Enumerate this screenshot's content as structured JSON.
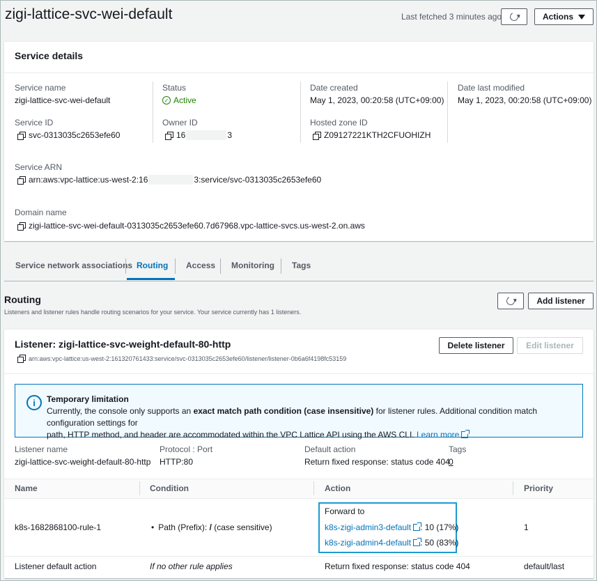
{
  "header": {
    "title": "zigi-lattice-svc-wei-default",
    "last_fetched": "Last fetched 3 minutes ago",
    "actions_label": "Actions"
  },
  "service_details": {
    "heading": "Service details",
    "fields": {
      "service_name_label": "Service name",
      "service_name": "zigi-lattice-svc-wei-default",
      "status_label": "Status",
      "status": "Active",
      "date_created_label": "Date created",
      "date_created": "May 1, 2023, 00:20:58 (UTC+09:00)",
      "date_modified_label": "Date last modified",
      "date_modified": "May 1, 2023, 00:20:58 (UTC+09:00)",
      "service_id_label": "Service ID",
      "service_id": "svc-0313035c2653efe60",
      "owner_id_label": "Owner ID",
      "owner_id_start": "16",
      "owner_id_end": "3",
      "hosted_zone_label": "Hosted zone ID",
      "hosted_zone": "Z09127221KTH2CFUOHIZH",
      "arn_label": "Service ARN",
      "arn_start": "arn:aws:vpc-lattice:us-west-2:16",
      "arn_end": "3:service/svc-0313035c2653efe60",
      "domain_label": "Domain name",
      "domain": "zigi-lattice-svc-wei-default-0313035c2653efe60.7d67968.vpc-lattice-svcs.us-west-2.on.aws"
    }
  },
  "tabs": [
    {
      "label": "Service network associations"
    },
    {
      "label": "Routing"
    },
    {
      "label": "Access"
    },
    {
      "label": "Monitoring"
    },
    {
      "label": "Tags"
    }
  ],
  "routing": {
    "heading": "Routing",
    "description": "Listeners and listener rules handle routing scenarios for your service. Your service currently has 1 listeners.",
    "add_listener_label": "Add listener"
  },
  "listener": {
    "title": "Listener: zigi-lattice-svc-weight-default-80-http",
    "arn": "arn:aws:vpc-lattice:us-west-2:161320761433:service/svc-0313035c2653efe60/listener/listener-0b6a6f4198fc53159",
    "delete_label": "Delete listener",
    "edit_label": "Edit listener",
    "info": {
      "title": "Temporary limitation",
      "text_1": "Currently, the console only supports an ",
      "text_bold": "exact match path condition (case insensitive)",
      "text_2": " for listener rules. Additional condition match configuration settings for",
      "text_3": "path, HTTP method, and header are accommodated within the VPC Lattice API using the AWS CLI.",
      "learn_more": "Learn more"
    },
    "summary": {
      "name_label": "Listener name",
      "name": "zigi-lattice-svc-weight-default-80-http",
      "protocol_label": "Protocol : Port",
      "protocol": "HTTP:80",
      "default_label": "Default action",
      "default": "Return fixed response: status code 404",
      "tags_label": "Tags",
      "tags": "0"
    }
  },
  "rules_table": {
    "headers": [
      "Name",
      "Condition",
      "Action",
      "Priority"
    ],
    "rows": [
      {
        "name": "k8s-1682868100-rule-1",
        "condition_prefix": "Path (Prefix): ",
        "condition_value": "/",
        "condition_suffix": " (case sensitive)",
        "action_title": "Forward to",
        "target_1": "k8s-zigi-admin3-default",
        "target_1_weight": ": 10 (17%)",
        "target_2": "k8s-zigi-admin4-default",
        "target_2_weight": ": 50 (83%)",
        "priority": "1"
      },
      {
        "name": "Listener default action",
        "condition": "If no other rule applies",
        "action": "Return fixed response: status code 404",
        "priority": "default/last"
      }
    ]
  },
  "colors": {
    "link": "#0073bb",
    "active": "#1d8102",
    "info_bg": "#f1faff",
    "info_border": "#0073bb",
    "highlight": "#1b9bd1"
  }
}
